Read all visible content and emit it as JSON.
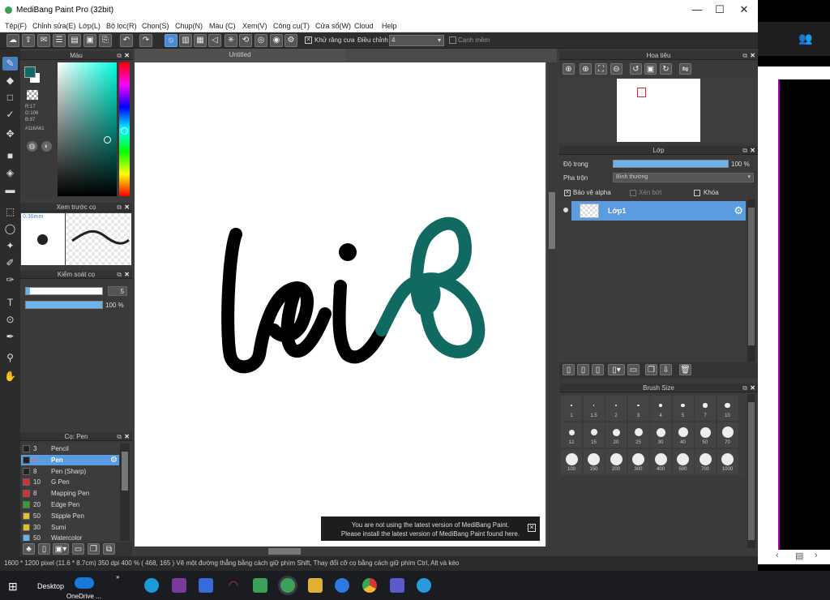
{
  "window": {
    "title": "MediBang Paint Pro (32bit)",
    "min": "—",
    "max": "☐",
    "close": "✕"
  },
  "menu": [
    "Tệp(F)",
    "Chỉnh sửa(E)",
    "Lớp(L)",
    "Bộ lọc(R)",
    "Chọn(S)",
    "Chụp(N)",
    "Màu (C)",
    "Xem(V)",
    "Công cụ(T)",
    "Cửa sổ(W)",
    "Cloud",
    "Help"
  ],
  "toolbar": {
    "antialias_label": "Khử răng cưa",
    "adjust_label": "Điều chỉnh",
    "adjust_value": "4",
    "edge_label": "Cạnh mềm"
  },
  "color_panel": {
    "title": "Màu",
    "r": "R:17",
    "g": "G:106",
    "b": "B:97",
    "hex": "#116A61",
    "fg": "#116A61"
  },
  "brush_preview": {
    "title": "Xem trước cọ",
    "size": "0.36mm"
  },
  "brush_control": {
    "title": "Kiểm soát cọ",
    "size_value": "5",
    "opacity_value": "100 %",
    "size_fraction": 0.05,
    "opacity_fraction": 1.0
  },
  "brush_list": {
    "title": "Cọ: Pen",
    "items": [
      {
        "size": "3",
        "name": "Pencil",
        "color": "#222222"
      },
      {
        "size": "5",
        "name": "Pen",
        "color": "#222222",
        "selected": true
      },
      {
        "size": "8",
        "name": "Pen (Sharp)",
        "color": "#222222"
      },
      {
        "size": "10",
        "name": "G Pen",
        "color": "#d33030"
      },
      {
        "size": "8",
        "name": "Mapping Pen",
        "color": "#d33030"
      },
      {
        "size": "20",
        "name": "Edge Pen",
        "color": "#2fa52f"
      },
      {
        "size": "50",
        "name": "Stipple Pen",
        "color": "#e0c030"
      },
      {
        "size": "30",
        "name": "Sumi",
        "color": "#e0c030"
      },
      {
        "size": "50",
        "name": "Watercolor",
        "color": "#6ab3ef"
      }
    ]
  },
  "canvas": {
    "tab": "Untitled",
    "notice_line1": "You are not using the latest version of MediBang Paint.",
    "notice_line2": "Please install the latest version of MediBang Paint found here."
  },
  "navigator": {
    "title": "Hoa tiêu"
  },
  "layers": {
    "title": "Lớp",
    "opacity_label": "Độ trong",
    "opacity_value": "100 %",
    "opacity_fraction": 1.0,
    "blend_label": "Pha trộn",
    "blend_value": "Bình thường",
    "protect_alpha": "Bảo vệ alpha",
    "clip": "Xén bớt",
    "lock": "Khóa",
    "layer_name": "Lớp1"
  },
  "brush_size": {
    "title": "Brush Size",
    "sizes": [
      "1",
      "1.5",
      "2",
      "3",
      "4",
      "5",
      "7",
      "10",
      "12",
      "15",
      "20",
      "25",
      "30",
      "40",
      "50",
      "70",
      "100",
      "150",
      "200",
      "300",
      "400",
      "500",
      "700",
      "1000"
    ]
  },
  "status": {
    "text": "1600 * 1200 pixel   (11.6 * 8.7cm)   350 dpi   400 %   ( 468, 165 )   Vẽ một đường thẳng bằng cách giữ phím Shift, Thay đổi cỡ cọ bằng cách giữ phím Ctrl, Alt và kéo"
  },
  "taskbar": {
    "desktop": "Desktop",
    "onedrive": "OneDrive ..."
  }
}
